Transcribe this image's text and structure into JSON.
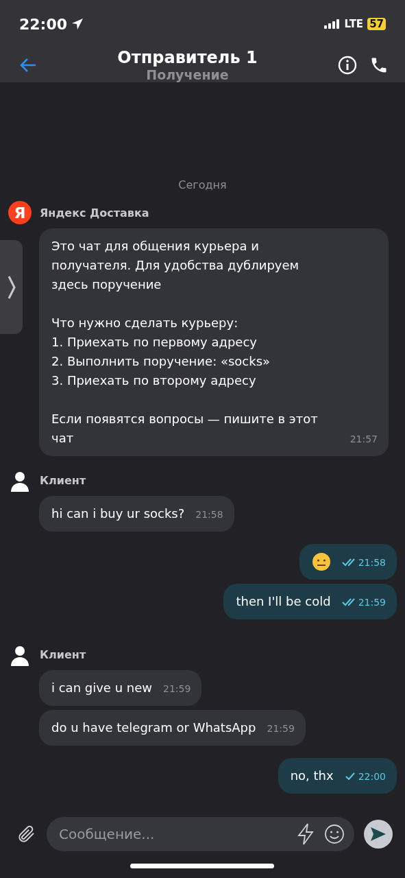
{
  "status_bar": {
    "time": "22:00",
    "network": "LTE",
    "battery": "57"
  },
  "header": {
    "title": "Отправитель 1",
    "subtitle": "Получение"
  },
  "chat": {
    "date": "Сегодня",
    "groups": [
      {
        "kind": "incoming",
        "sender": {
          "name": "Яндекс Доставка",
          "kind": "logo",
          "logo_letter": "Я"
        },
        "messages": [
          {
            "kind": "text",
            "text": "Это чат для общения курьера и получателя. Для удобства дублируем здесь поручение\n\nЧто нужно сделать курьеру:\n1. Приехать по первому адресу\n2. Выполнить поручение: «socks»\n3. Приехать по второму адресу\n\nЕсли появятся вопросы — пишите в этот чат",
            "time": "21:57"
          }
        ]
      },
      {
        "kind": "incoming",
        "sender": {
          "name": "Клиент",
          "kind": "person"
        },
        "messages": [
          {
            "kind": "text",
            "text": "hi can i buy ur socks?",
            "time": "21:58"
          }
        ]
      },
      {
        "kind": "outgoing",
        "messages": [
          {
            "kind": "emoji",
            "time": "21:58",
            "read": true
          },
          {
            "kind": "text",
            "text": "then I'll be cold",
            "time": "21:59",
            "read": true
          }
        ]
      },
      {
        "kind": "incoming",
        "sender": {
          "name": "Клиент",
          "kind": "person"
        },
        "messages": [
          {
            "kind": "text",
            "text": "i can give u new",
            "time": "21:59"
          },
          {
            "kind": "text",
            "text": "do u have telegram or WhatsApp",
            "time": "21:59"
          }
        ]
      },
      {
        "kind": "outgoing",
        "messages": [
          {
            "kind": "text",
            "text": "no, thx",
            "time": "22:00",
            "read": false
          }
        ]
      }
    ]
  },
  "composer": {
    "placeholder": "Сообщение..."
  }
}
